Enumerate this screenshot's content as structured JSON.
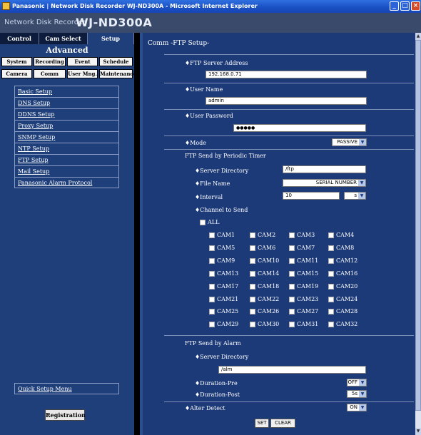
{
  "window": {
    "title": "Panasonic | Network Disk Recorder WJ-ND300A - Microsoft Internet Explorer"
  },
  "header": {
    "product": "Network Disk Recorder",
    "model": "WJ-ND300A"
  },
  "tabs": [
    {
      "label": "Control"
    },
    {
      "label": "Cam Select"
    },
    {
      "label": "Setup"
    }
  ],
  "advanced": {
    "title": "Advanced",
    "buttons": [
      "System",
      "Recording",
      "Event",
      "Schedule",
      "Camera",
      "Comm",
      "User Mng.",
      "Maintenance"
    ]
  },
  "menu": [
    "Basic Setup",
    "DNS Setup",
    "DDNS Setup",
    "Proxy Setup",
    "SNMP Setup",
    "NTP Setup",
    "FTP Setup",
    "Mail Setup",
    "Panasonic Alarm Protocol"
  ],
  "quick_setup": "Quick Setup Menu",
  "registration": "Registration",
  "page_title": "Comm -FTP Setup-",
  "ftp": {
    "server_address_label": "♦FTP Server Address",
    "server_address": "192.168.0.71",
    "user_name_label": "♦User Name",
    "user_name": "admin",
    "password_label": "♦User Password",
    "password": "●●●●●",
    "mode_label": "♦Mode",
    "mode": "PASSIVE"
  },
  "periodic": {
    "section": "FTP Send by Periodic Timer",
    "server_dir_label": "♦Server Directory",
    "server_dir": "/ftp",
    "file_name_label": "♦File Name",
    "file_name": "SERIAL NUMBER",
    "interval_label": "♦Interval",
    "interval": "10",
    "interval_unit": "s",
    "channel_label": "♦Channel to Send",
    "all_label": "ALL",
    "cams": [
      "CAM1",
      "CAM2",
      "CAM3",
      "CAM4",
      "CAM5",
      "CAM6",
      "CAM7",
      "CAM8",
      "CAM9",
      "CAM10",
      "CAM11",
      "CAM12",
      "CAM13",
      "CAM14",
      "CAM15",
      "CAM16",
      "CAM17",
      "CAM18",
      "CAM19",
      "CAM20",
      "CAM21",
      "CAM22",
      "CAM23",
      "CAM24",
      "CAM25",
      "CAM26",
      "CAM27",
      "CAM28",
      "CAM29",
      "CAM30",
      "CAM31",
      "CAM32"
    ]
  },
  "alarm": {
    "section": "FTP Send by Alarm",
    "server_dir_label": "♦Server Directory",
    "server_dir": "/alm",
    "duration_pre_label": "♦Duration-Pre",
    "duration_pre": "OFF",
    "duration_post_label": "♦Duration-Post",
    "duration_post": "5s"
  },
  "alter_detect": {
    "label": "♦Alter Detect",
    "value": "ON"
  },
  "actions": {
    "set": "SET",
    "clear": "CLEAR"
  },
  "icons": {
    "select_arrow": "chevron-down-icon",
    "scroll_up": "scroll-up-icon",
    "scroll_down": "scroll-down-icon"
  },
  "colors": {
    "panel": "#1d3a78",
    "sidebar": "#1f3f7a",
    "header": "#3a4a6a",
    "titlebar": "#1a4fc2"
  }
}
